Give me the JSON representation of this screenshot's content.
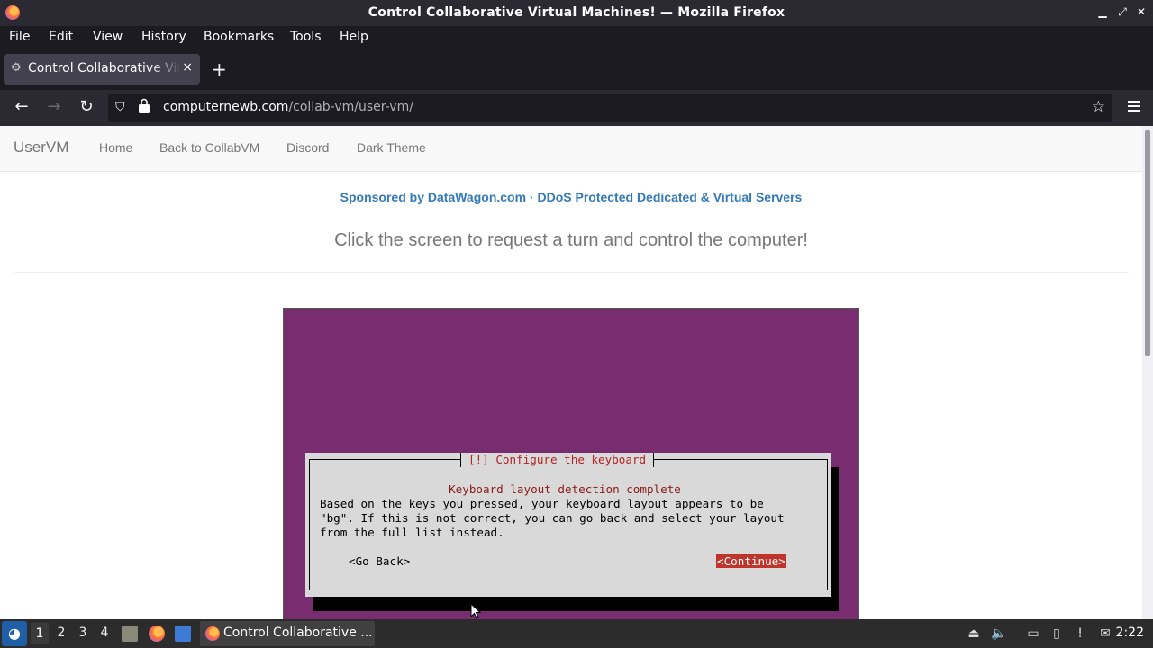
{
  "window": {
    "title": "Control Collaborative Virtual Machines! — Mozilla Firefox",
    "minimize_icon": "minimize-icon",
    "maximize_icon": "restore-icon",
    "close_icon": "close-icon"
  },
  "menubar": {
    "items": [
      "File",
      "Edit",
      "View",
      "History",
      "Bookmarks",
      "Tools",
      "Help"
    ]
  },
  "tabs": [
    {
      "title": "Control Collaborative Virtual Machines!",
      "close": "×"
    }
  ],
  "newtab": "+",
  "navbar": {
    "back": "←",
    "forward": "→",
    "reload": "↻",
    "url_domain": "computernewb.com",
    "url_path": "/collab-vm/user-vm/",
    "star": "☆"
  },
  "site": {
    "brand": "UserVM",
    "nav": [
      "Home",
      "Back to CollabVM",
      "Discord",
      "Dark Theme"
    ],
    "sponsor": "Sponsored by DataWagon.com · DDoS Protected Dedicated & Virtual Servers",
    "prompt": "Click the screen to request a turn and control the computer!"
  },
  "vm_screen": {
    "dialog_title": "[!] Configure the keyboard",
    "heading": "Keyboard layout detection complete",
    "body": "Based on the keys you pressed, your keyboard layout appears to be\n\"bg\". If this is not correct, you can go back and select your layout\nfrom the full list instead.",
    "go_back": "<Go Back>",
    "continue": "<Continue>"
  },
  "taskbar": {
    "workspaces": [
      "1",
      "2",
      "3",
      "4"
    ],
    "active_workspace": "1",
    "task_label": "Control Collaborative ...",
    "clock": "2:22"
  }
}
